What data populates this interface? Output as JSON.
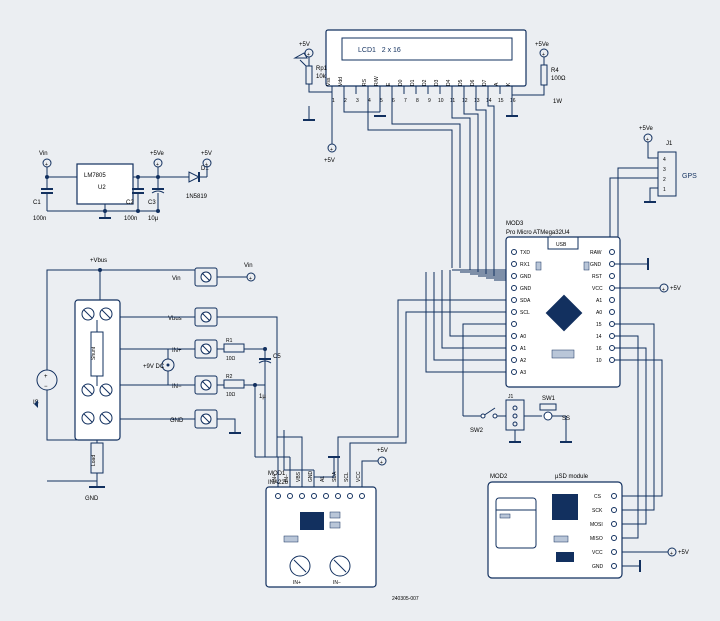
{
  "lcd": {
    "ref": "LCD1",
    "desc": "2 x 16",
    "pins": [
      "Vss",
      "Vdd",
      "RS",
      "R/W",
      "E",
      "D0",
      "D1",
      "D2",
      "D3",
      "D4",
      "D5",
      "D6",
      "D7",
      "A",
      "K"
    ],
    "pin_numbers": [
      "1",
      "2",
      "3",
      "4",
      "5",
      "6",
      "7",
      "8",
      "9",
      "10",
      "11",
      "12",
      "13",
      "14",
      "15",
      "16"
    ]
  },
  "rp1": {
    "ref": "Rp1",
    "value": "10k"
  },
  "r4": {
    "ref": "R4",
    "value": "100Ω",
    "net": "1W"
  },
  "gps": {
    "ref": "J1",
    "label": "GPS",
    "pins": [
      "1",
      "2",
      "3",
      "4"
    ]
  },
  "power": {
    "vin": "Vin",
    "plus5v": "+5V",
    "plus5ve": "+5Ve",
    "lm7805": {
      "ref": "U2",
      "part": "LM7805"
    },
    "c1": {
      "ref": "C1",
      "value": "100n"
    },
    "c2": {
      "ref": "C2",
      "value": "100n"
    },
    "c3": {
      "ref": "C3",
      "value": "10µ"
    },
    "d1": {
      "ref": "D1",
      "part": "1N5819"
    }
  },
  "mod3": {
    "ref": "MOD3",
    "part": "Pro Micro ATMega32U4",
    "usb": "USB",
    "left_pins": [
      "TXD",
      "RX1",
      "GND",
      "GND",
      "SDA",
      "SCL",
      "",
      "A0",
      "A1",
      "A2",
      "A3"
    ],
    "right_pins": [
      "RAW",
      "GND",
      "RST",
      "VCC",
      "A1",
      "A0",
      "15",
      "14",
      "16",
      "10"
    ],
    "j1": "J1",
    "sw1": "SW1",
    "sw2": "SW2",
    "ss": "SS"
  },
  "left_block": {
    "vbus": "+Vbus",
    "labels": [
      "Vin",
      "Vbus",
      "IN+",
      "IN−",
      "GND"
    ],
    "r1": {
      "ref": "R1",
      "value": "10Ω"
    },
    "r2": {
      "ref": "R2",
      "value": "10Ω"
    },
    "c5": {
      "ref": "C5",
      "value": "1µ"
    },
    "dc": "+9V DC",
    "shunt": "Shunt",
    "is": "IS",
    "plus": "+",
    "minus": "−",
    "gnd": "GND",
    "load": "Load"
  },
  "mod1": {
    "ref": "MOD1",
    "part": "INA226",
    "pins": [
      "IN+",
      "IN−",
      "VBS",
      "GND",
      "AL",
      "SDA",
      "SCL",
      "VCC"
    ],
    "bottom": [
      "IN+",
      "IN−"
    ]
  },
  "mod2": {
    "ref": "MOD2",
    "part": "µSD module",
    "pins": [
      "CS",
      "SCK",
      "MOSI",
      "MISO",
      "VCC",
      "GND"
    ]
  },
  "drawing_id": "240305-007"
}
